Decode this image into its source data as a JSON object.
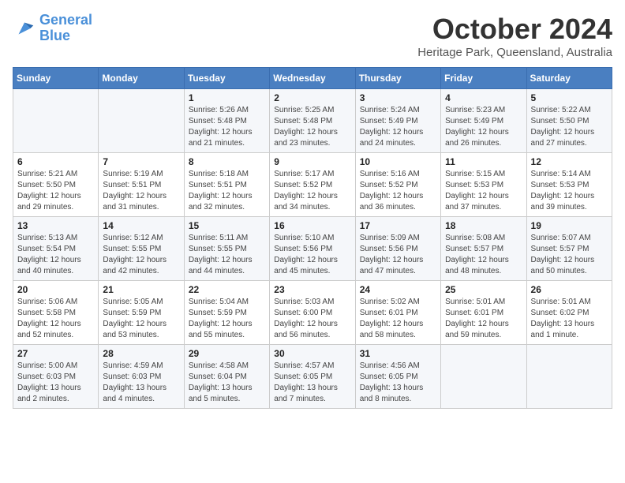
{
  "logo": {
    "line1": "General",
    "line2": "Blue"
  },
  "title": "October 2024",
  "location": "Heritage Park, Queensland, Australia",
  "headers": [
    "Sunday",
    "Monday",
    "Tuesday",
    "Wednesday",
    "Thursday",
    "Friday",
    "Saturday"
  ],
  "weeks": [
    [
      {
        "day": "",
        "info": ""
      },
      {
        "day": "",
        "info": ""
      },
      {
        "day": "1",
        "info": "Sunrise: 5:26 AM\nSunset: 5:48 PM\nDaylight: 12 hours and 21 minutes."
      },
      {
        "day": "2",
        "info": "Sunrise: 5:25 AM\nSunset: 5:48 PM\nDaylight: 12 hours and 23 minutes."
      },
      {
        "day": "3",
        "info": "Sunrise: 5:24 AM\nSunset: 5:49 PM\nDaylight: 12 hours and 24 minutes."
      },
      {
        "day": "4",
        "info": "Sunrise: 5:23 AM\nSunset: 5:49 PM\nDaylight: 12 hours and 26 minutes."
      },
      {
        "day": "5",
        "info": "Sunrise: 5:22 AM\nSunset: 5:50 PM\nDaylight: 12 hours and 27 minutes."
      }
    ],
    [
      {
        "day": "6",
        "info": "Sunrise: 5:21 AM\nSunset: 5:50 PM\nDaylight: 12 hours and 29 minutes."
      },
      {
        "day": "7",
        "info": "Sunrise: 5:19 AM\nSunset: 5:51 PM\nDaylight: 12 hours and 31 minutes."
      },
      {
        "day": "8",
        "info": "Sunrise: 5:18 AM\nSunset: 5:51 PM\nDaylight: 12 hours and 32 minutes."
      },
      {
        "day": "9",
        "info": "Sunrise: 5:17 AM\nSunset: 5:52 PM\nDaylight: 12 hours and 34 minutes."
      },
      {
        "day": "10",
        "info": "Sunrise: 5:16 AM\nSunset: 5:52 PM\nDaylight: 12 hours and 36 minutes."
      },
      {
        "day": "11",
        "info": "Sunrise: 5:15 AM\nSunset: 5:53 PM\nDaylight: 12 hours and 37 minutes."
      },
      {
        "day": "12",
        "info": "Sunrise: 5:14 AM\nSunset: 5:53 PM\nDaylight: 12 hours and 39 minutes."
      }
    ],
    [
      {
        "day": "13",
        "info": "Sunrise: 5:13 AM\nSunset: 5:54 PM\nDaylight: 12 hours and 40 minutes."
      },
      {
        "day": "14",
        "info": "Sunrise: 5:12 AM\nSunset: 5:55 PM\nDaylight: 12 hours and 42 minutes."
      },
      {
        "day": "15",
        "info": "Sunrise: 5:11 AM\nSunset: 5:55 PM\nDaylight: 12 hours and 44 minutes."
      },
      {
        "day": "16",
        "info": "Sunrise: 5:10 AM\nSunset: 5:56 PM\nDaylight: 12 hours and 45 minutes."
      },
      {
        "day": "17",
        "info": "Sunrise: 5:09 AM\nSunset: 5:56 PM\nDaylight: 12 hours and 47 minutes."
      },
      {
        "day": "18",
        "info": "Sunrise: 5:08 AM\nSunset: 5:57 PM\nDaylight: 12 hours and 48 minutes."
      },
      {
        "day": "19",
        "info": "Sunrise: 5:07 AM\nSunset: 5:57 PM\nDaylight: 12 hours and 50 minutes."
      }
    ],
    [
      {
        "day": "20",
        "info": "Sunrise: 5:06 AM\nSunset: 5:58 PM\nDaylight: 12 hours and 52 minutes."
      },
      {
        "day": "21",
        "info": "Sunrise: 5:05 AM\nSunset: 5:59 PM\nDaylight: 12 hours and 53 minutes."
      },
      {
        "day": "22",
        "info": "Sunrise: 5:04 AM\nSunset: 5:59 PM\nDaylight: 12 hours and 55 minutes."
      },
      {
        "day": "23",
        "info": "Sunrise: 5:03 AM\nSunset: 6:00 PM\nDaylight: 12 hours and 56 minutes."
      },
      {
        "day": "24",
        "info": "Sunrise: 5:02 AM\nSunset: 6:01 PM\nDaylight: 12 hours and 58 minutes."
      },
      {
        "day": "25",
        "info": "Sunrise: 5:01 AM\nSunset: 6:01 PM\nDaylight: 12 hours and 59 minutes."
      },
      {
        "day": "26",
        "info": "Sunrise: 5:01 AM\nSunset: 6:02 PM\nDaylight: 13 hours and 1 minute."
      }
    ],
    [
      {
        "day": "27",
        "info": "Sunrise: 5:00 AM\nSunset: 6:03 PM\nDaylight: 13 hours and 2 minutes."
      },
      {
        "day": "28",
        "info": "Sunrise: 4:59 AM\nSunset: 6:03 PM\nDaylight: 13 hours and 4 minutes."
      },
      {
        "day": "29",
        "info": "Sunrise: 4:58 AM\nSunset: 6:04 PM\nDaylight: 13 hours and 5 minutes."
      },
      {
        "day": "30",
        "info": "Sunrise: 4:57 AM\nSunset: 6:05 PM\nDaylight: 13 hours and 7 minutes."
      },
      {
        "day": "31",
        "info": "Sunrise: 4:56 AM\nSunset: 6:05 PM\nDaylight: 13 hours and 8 minutes."
      },
      {
        "day": "",
        "info": ""
      },
      {
        "day": "",
        "info": ""
      }
    ]
  ]
}
